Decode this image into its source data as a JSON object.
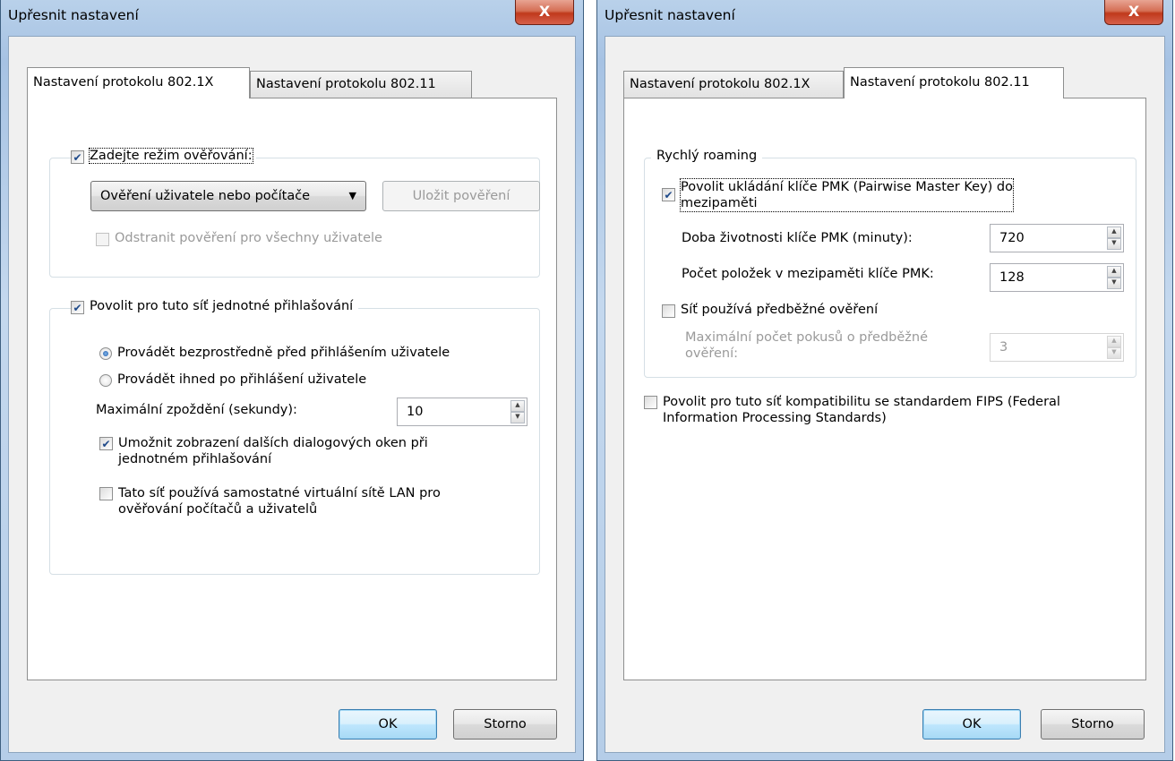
{
  "left_dialog": {
    "title": "Upřesnit nastavení",
    "close_glyph": "X",
    "tabs": [
      {
        "label": "Nastavení protokolu 802.1X",
        "active": true
      },
      {
        "label": "Nastavení protokolu 802.11",
        "active": false
      }
    ],
    "auth_group": {
      "checkbox_label": "Zadejte režim ověřování:",
      "checked": true,
      "mode_value": "Ověření uživatele nebo počítače",
      "save_button": "Uložit pověření",
      "delete_label": "Odstranit pověření pro všechny uživatele",
      "delete_checked": false
    },
    "sso_group": {
      "checkbox_label": "Povolit pro tuto síť jednotné přihlašování",
      "checked": true,
      "radio_before": "Provádět bezprostředně před přihlášením uživatele",
      "radio_before_selected": true,
      "radio_after": "Provádět ihned po přihlášení uživatele",
      "radio_after_selected": false,
      "delay_label": "Maximální zpoždění (sekundy):",
      "delay_value": "10",
      "dialogs_label_line1": "Umožnit zobrazení dalších dialogových oken při",
      "dialogs_label_line2": "jednotném přihlašování",
      "dialogs_checked": true,
      "vlan_label_line1": "Tato síť používá samostatné virtuální sítě LAN pro",
      "vlan_label_line2": "ověřování počítačů a uživatelů",
      "vlan_checked": false
    },
    "ok_button": "OK",
    "cancel_button": "Storno"
  },
  "right_dialog": {
    "title": "Upřesnit nastavení",
    "close_glyph": "X",
    "tabs": [
      {
        "label": "Nastavení protokolu 802.1X",
        "active": false
      },
      {
        "label": "Nastavení protokolu 802.11",
        "active": true
      }
    ],
    "roaming_group": {
      "legend": "Rychlý roaming",
      "pmk_cache_label_line1": "Povolit ukládání klíče PMK (Pairwise Master Key) do",
      "pmk_cache_label_line2": "mezipaměti",
      "pmk_cache_checked": true,
      "pmk_lifetime_label": "Doba životnosti klíče PMK (minuty):",
      "pmk_lifetime_value": "720",
      "pmk_entries_label": "Počet položek v mezipaměti klíče PMK:",
      "pmk_entries_value": "128",
      "preauth_label": "Síť používá předběžné ověření",
      "preauth_checked": false,
      "preauth_max_label_line1": "Maximální počet pokusů o předběžné",
      "preauth_max_label_line2": "ověření:",
      "preauth_max_value": "3"
    },
    "fips_label_line1": "Povolit pro tuto síť kompatibilitu se standardem FIPS (Federal",
    "fips_label_line2": "Information Processing Standards)",
    "fips_checked": false,
    "ok_button": "OK",
    "cancel_button": "Storno"
  }
}
